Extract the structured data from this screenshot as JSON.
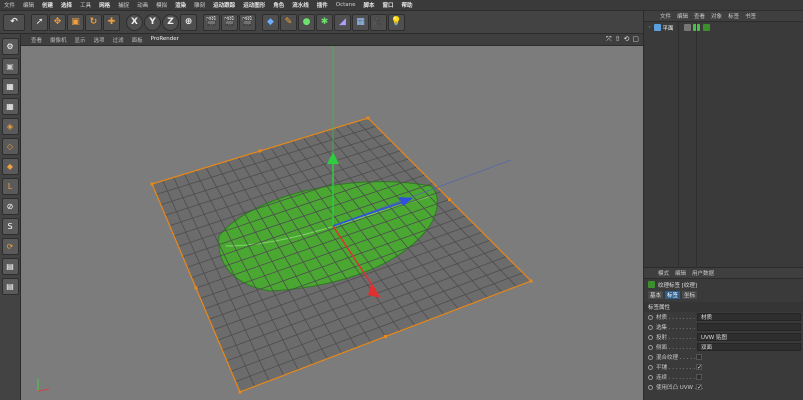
{
  "menu": [
    "文件",
    "编辑",
    "创建",
    "选择",
    "工具",
    "网格",
    "捕捉",
    "动画",
    "模拟",
    "渲染",
    "雕刻",
    "运动跟踪",
    "运动图形",
    "角色",
    "流水线",
    "插件",
    "Octane",
    "脚本",
    "窗口",
    "帮助"
  ],
  "menu_highlight": [
    2,
    3,
    5,
    9,
    11,
    12,
    13,
    14,
    15,
    17,
    18,
    19
  ],
  "toolbar": {
    "undo_icon": "undo-icon",
    "axis_labels": [
      "X",
      "Y",
      "Z"
    ]
  },
  "viewport_menu": [
    "查看",
    "摄像机",
    "显示",
    "选项",
    "过滤",
    "面板",
    "ProRender"
  ],
  "viewport_menu_active": 6,
  "viewport_icons": [
    "⤧",
    "⇧",
    "⟲",
    "▢"
  ],
  "right_tabs": [
    "文件",
    "编辑",
    "查看",
    "对象",
    "标签",
    "书签"
  ],
  "object": {
    "name": "平面"
  },
  "attr_tabs": [
    "模式",
    "编辑",
    "用户数据"
  ],
  "attr_title": "纹理标签 [纹理]",
  "attr_modes": [
    "基本",
    "标签",
    "坐标"
  ],
  "attr_mode_active": 1,
  "section": "标签属性",
  "props": [
    {
      "label": "材质 . . . . . . . .",
      "value": "材质",
      "kind": "field"
    },
    {
      "label": "选集 . . . . . . . .",
      "value": "",
      "kind": "field"
    },
    {
      "label": "投射 . . . . . . . .",
      "value": "UVW 贴图",
      "kind": "field"
    },
    {
      "label": "侧面 . . . . . . . .",
      "value": "双面",
      "kind": "field"
    },
    {
      "label": "混合纹理 . . . . . .",
      "value": "",
      "kind": "check"
    },
    {
      "label": "平铺 . . . . . . . .",
      "value": "✓",
      "kind": "check"
    },
    {
      "label": "连续 . . . . . . . .",
      "value": "",
      "kind": "check"
    },
    {
      "label": "使用凹凸 UVW . . .",
      "value": "✓",
      "kind": "check"
    }
  ],
  "colors": {
    "grid": "#4d4d4d",
    "edge": "#e8891a",
    "leaf": "#4aa832",
    "axis_y": "#2ecc40",
    "axis_x": "#e03030",
    "axis_z": "#3050e0"
  }
}
